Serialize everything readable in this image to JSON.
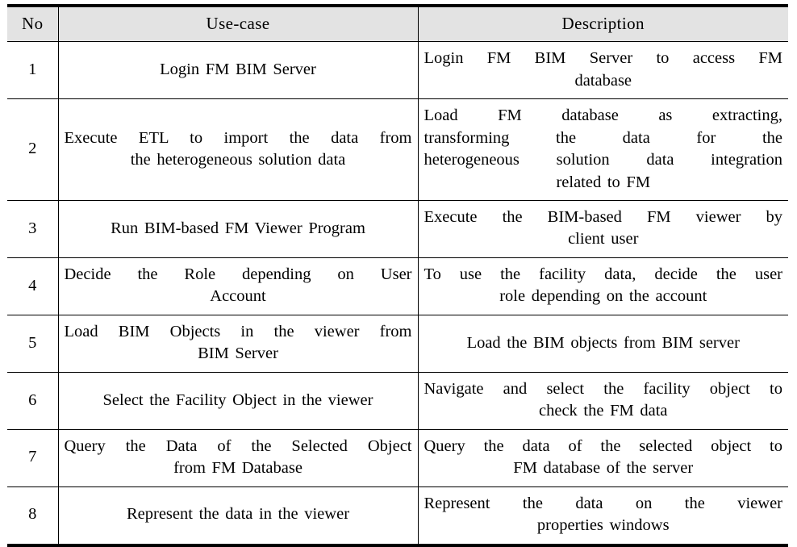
{
  "table": {
    "columns": [
      {
        "key": "no",
        "label": "No"
      },
      {
        "key": "usecase",
        "label": "Use-case"
      },
      {
        "key": "description",
        "label": "Description"
      }
    ],
    "header_background": "#e3e3e3",
    "rule_color": "#000000",
    "rows": [
      {
        "no": "1",
        "usecase_lines": [
          "Login FM BIM Server"
        ],
        "description_lines": [
          "Login FM BIM Server to access FM",
          "database"
        ],
        "description_justify_first": true
      },
      {
        "no": "2",
        "usecase_lines": [
          "Execute ETL to import the data from",
          "the heterogeneous solution data"
        ],
        "description_lines": [
          "Load FM database as extracting,",
          "transforming the data for the",
          "heterogeneous solution data integration",
          "related to FM"
        ],
        "description_justify_first": false
      },
      {
        "no": "3",
        "usecase_lines": [
          "Run BIM-based FM Viewer Program"
        ],
        "description_lines": [
          "Execute the BIM-based FM viewer by",
          "client user"
        ],
        "description_justify_first": false
      },
      {
        "no": "4",
        "usecase_lines": [
          "Decide the Role depending on User",
          "Account"
        ],
        "description_lines": [
          "To use the facility data, decide the user",
          "role depending on the account"
        ],
        "description_justify_first": false
      },
      {
        "no": "5",
        "usecase_lines": [
          "Load BIM Objects in the viewer from",
          "BIM Server"
        ],
        "description_lines": [
          "Load the BIM objects from BIM server"
        ],
        "description_justify_first": false
      },
      {
        "no": "6",
        "usecase_lines": [
          "Select the Facility Object in the viewer"
        ],
        "description_lines": [
          "Navigate and select the facility object to",
          "check the FM data"
        ],
        "description_justify_first": false
      },
      {
        "no": "7",
        "usecase_lines": [
          "Query the Data of the Selected Object",
          "from FM Database"
        ],
        "description_lines": [
          "Query the data of the selected object to",
          "FM database of the server"
        ],
        "description_justify_first": false
      },
      {
        "no": "8",
        "usecase_lines": [
          "Represent the data in the viewer"
        ],
        "description_lines": [
          "Represent the data on the viewer",
          "properties windows"
        ],
        "description_justify_first": false
      }
    ]
  }
}
